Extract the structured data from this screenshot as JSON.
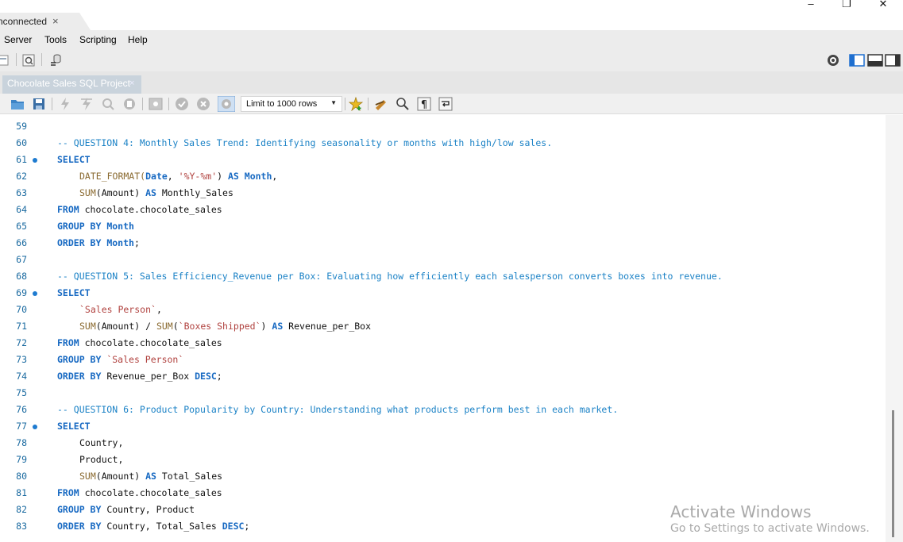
{
  "titlebar": {
    "connection_tab": "nconnected",
    "connection_tab_close": "×",
    "minimize": "–",
    "maximize": "❐",
    "close": "✕"
  },
  "menu": [
    "Server",
    "Tools",
    "Scripting",
    "Help"
  ],
  "editor_tab": {
    "title": "Chocolate Sales SQL Project",
    "close": "×"
  },
  "sql_toolbar": {
    "limit": "Limit to 1000 rows"
  },
  "editor": {
    "lines": [
      {
        "n": "59",
        "dot": false,
        "indent": false,
        "tokens": []
      },
      {
        "n": "60",
        "dot": false,
        "indent": false,
        "tokens": [
          {
            "t": "-- QUESTION 4: Monthly Sales Trend: Identifying seasonality or months with high/low sales.",
            "c": "cm"
          }
        ]
      },
      {
        "n": "61",
        "dot": true,
        "indent": false,
        "tokens": [
          {
            "t": "SELECT",
            "c": "kw"
          }
        ]
      },
      {
        "n": "62",
        "dot": false,
        "indent": true,
        "tokens": [
          {
            "t": "DATE_FORMAT(",
            "c": "fn"
          },
          {
            "t": "Date",
            "c": "id"
          },
          {
            "t": ", ",
            "c": "pl"
          },
          {
            "t": "'%Y-%m'",
            "c": "str"
          },
          {
            "t": ") ",
            "c": "pl"
          },
          {
            "t": "AS",
            "c": "kw"
          },
          {
            "t": " ",
            "c": "pl"
          },
          {
            "t": "Month",
            "c": "id"
          },
          {
            "t": ",",
            "c": "pl"
          }
        ]
      },
      {
        "n": "63",
        "dot": false,
        "indent": true,
        "tokens": [
          {
            "t": "SUM",
            "c": "fn"
          },
          {
            "t": "(Amount) ",
            "c": "pl"
          },
          {
            "t": "AS",
            "c": "kw"
          },
          {
            "t": " Monthly_Sales",
            "c": "pl"
          }
        ]
      },
      {
        "n": "64",
        "dot": false,
        "indent": false,
        "tokens": [
          {
            "t": "FROM",
            "c": "kw"
          },
          {
            "t": " chocolate.chocolate_sales",
            "c": "pl"
          }
        ]
      },
      {
        "n": "65",
        "dot": false,
        "indent": false,
        "tokens": [
          {
            "t": "GROUP BY",
            "c": "kw"
          },
          {
            "t": " ",
            "c": "pl"
          },
          {
            "t": "Month",
            "c": "id"
          }
        ]
      },
      {
        "n": "66",
        "dot": false,
        "indent": false,
        "tokens": [
          {
            "t": "ORDER BY",
            "c": "kw"
          },
          {
            "t": " ",
            "c": "pl"
          },
          {
            "t": "Month",
            "c": "id"
          },
          {
            "t": ";",
            "c": "pl"
          }
        ]
      },
      {
        "n": "67",
        "dot": false,
        "indent": false,
        "tokens": []
      },
      {
        "n": "68",
        "dot": false,
        "indent": false,
        "tokens": [
          {
            "t": "-- QUESTION 5: Sales Efficiency_Revenue per Box: Evaluating how efficiently each salesperson converts boxes into revenue.",
            "c": "cm"
          }
        ]
      },
      {
        "n": "69",
        "dot": true,
        "indent": false,
        "tokens": [
          {
            "t": "SELECT",
            "c": "kw"
          }
        ]
      },
      {
        "n": "70",
        "dot": false,
        "indent": true,
        "tokens": [
          {
            "t": "`Sales Person`",
            "c": "str"
          },
          {
            "t": ",",
            "c": "pl"
          }
        ]
      },
      {
        "n": "71",
        "dot": false,
        "indent": true,
        "tokens": [
          {
            "t": "SUM",
            "c": "fn"
          },
          {
            "t": "(Amount) / ",
            "c": "pl"
          },
          {
            "t": "SUM",
            "c": "fn"
          },
          {
            "t": "(",
            "c": "pl"
          },
          {
            "t": "`Boxes Shipped`",
            "c": "str"
          },
          {
            "t": ") ",
            "c": "pl"
          },
          {
            "t": "AS",
            "c": "kw"
          },
          {
            "t": " Revenue_per_Box",
            "c": "pl"
          }
        ]
      },
      {
        "n": "72",
        "dot": false,
        "indent": false,
        "tokens": [
          {
            "t": "FROM",
            "c": "kw"
          },
          {
            "t": " chocolate.chocolate_sales",
            "c": "pl"
          }
        ]
      },
      {
        "n": "73",
        "dot": false,
        "indent": false,
        "tokens": [
          {
            "t": "GROUP BY",
            "c": "kw"
          },
          {
            "t": " ",
            "c": "pl"
          },
          {
            "t": "`Sales Person`",
            "c": "str"
          }
        ]
      },
      {
        "n": "74",
        "dot": false,
        "indent": false,
        "tokens": [
          {
            "t": "ORDER BY",
            "c": "kw"
          },
          {
            "t": " Revenue_per_Box ",
            "c": "pl"
          },
          {
            "t": "DESC",
            "c": "kw"
          },
          {
            "t": ";",
            "c": "pl"
          }
        ]
      },
      {
        "n": "75",
        "dot": false,
        "indent": false,
        "tokens": []
      },
      {
        "n": "76",
        "dot": false,
        "indent": false,
        "tokens": [
          {
            "t": "-- QUESTION 6: Product Popularity by Country: Understanding what products perform best in each market.",
            "c": "cm"
          }
        ]
      },
      {
        "n": "77",
        "dot": true,
        "indent": false,
        "tokens": [
          {
            "t": "SELECT",
            "c": "kw"
          }
        ]
      },
      {
        "n": "78",
        "dot": false,
        "indent": true,
        "tokens": [
          {
            "t": "Country,",
            "c": "pl"
          }
        ]
      },
      {
        "n": "79",
        "dot": false,
        "indent": true,
        "tokens": [
          {
            "t": "Product,",
            "c": "pl"
          }
        ]
      },
      {
        "n": "80",
        "dot": false,
        "indent": true,
        "tokens": [
          {
            "t": "SUM",
            "c": "fn"
          },
          {
            "t": "(Amount) ",
            "c": "pl"
          },
          {
            "t": "AS",
            "c": "kw"
          },
          {
            "t": " Total_Sales",
            "c": "pl"
          }
        ]
      },
      {
        "n": "81",
        "dot": false,
        "indent": false,
        "tokens": [
          {
            "t": "FROM",
            "c": "kw"
          },
          {
            "t": " chocolate.chocolate_sales",
            "c": "pl"
          }
        ]
      },
      {
        "n": "82",
        "dot": false,
        "indent": false,
        "tokens": [
          {
            "t": "GROUP BY",
            "c": "kw"
          },
          {
            "t": " Country, Product",
            "c": "pl"
          }
        ]
      },
      {
        "n": "83",
        "dot": false,
        "indent": false,
        "tokens": [
          {
            "t": "ORDER BY",
            "c": "kw"
          },
          {
            "t": " Country, Total_Sales ",
            "c": "pl"
          },
          {
            "t": "DESC",
            "c": "kw"
          },
          {
            "t": ";",
            "c": "pl"
          }
        ]
      }
    ]
  },
  "watermark": {
    "title": "Activate Windows",
    "subtitle": "Go to Settings to activate Windows."
  }
}
